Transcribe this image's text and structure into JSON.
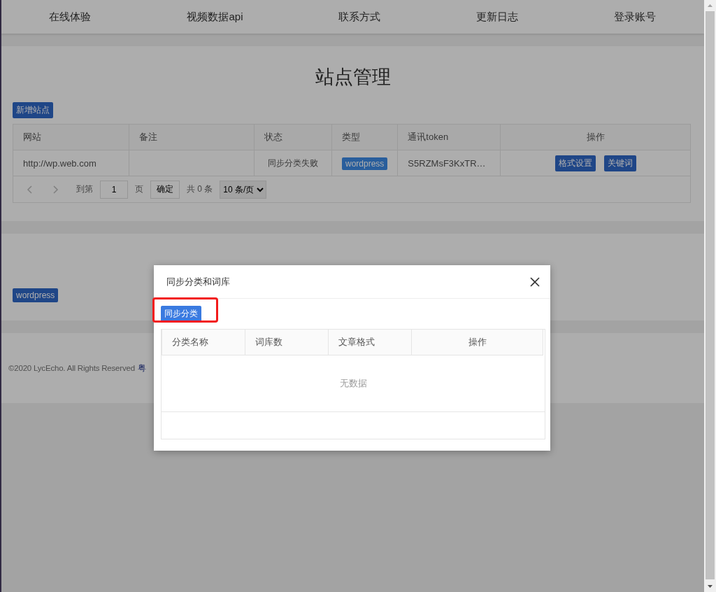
{
  "nav": {
    "items": [
      "在线体验",
      "视频数据api",
      "联系方式",
      "更新日志",
      "登录账号"
    ]
  },
  "sites": {
    "title": "站点管理",
    "add_button": "新增站点",
    "columns": [
      "网站",
      "备注",
      "状态",
      "类型",
      "通讯token",
      "操作"
    ],
    "rows": [
      {
        "site": "http://wp.web.com",
        "note": "",
        "status": "同步分类失败",
        "type": "wordpress",
        "token": "S5RZMsF3KxTR…",
        "actions": [
          "格式设置",
          "关键词"
        ]
      }
    ],
    "pager": {
      "goto_label": "到第",
      "page": "1",
      "page_unit": "页",
      "confirm": "确定",
      "total": "共 0 条",
      "page_size": "10 条/页"
    }
  },
  "plugins": {
    "buttons": [
      "wordpress"
    ]
  },
  "footer": {
    "text": "©2020 LycEcho. All Rights Reserved",
    "link": "粤"
  },
  "dialog": {
    "title": "同步分类和词库",
    "action_button": "同步分类",
    "highlighted": true,
    "columns": [
      "分类名称",
      "词库数",
      "文章格式",
      "操作"
    ],
    "empty_text": "无数据"
  }
}
